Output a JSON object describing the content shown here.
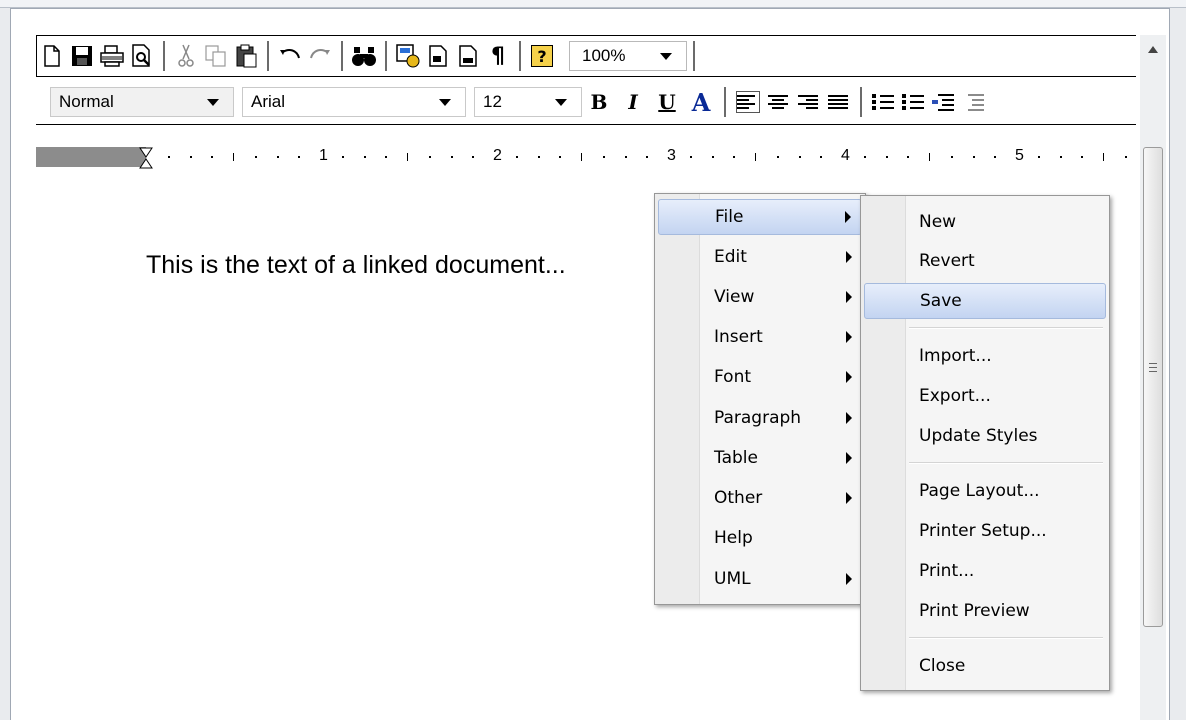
{
  "toolbar": {
    "zoom": "100%",
    "style_value": "Normal",
    "font_value": "Arial",
    "size_value": "12",
    "bold_label": "B",
    "italic_label": "I",
    "underline_label": "U",
    "font_color_label": "A",
    "paragraph_mark": "¶",
    "help_label": "?"
  },
  "ruler": {
    "numbers": [
      "1",
      "2",
      "3",
      "4",
      "5"
    ]
  },
  "document": {
    "text": "This is the text of a linked document..."
  },
  "context_menu": {
    "items": [
      {
        "label": "File",
        "has_submenu": true,
        "highlighted": true
      },
      {
        "label": "Edit",
        "has_submenu": true
      },
      {
        "label": "View",
        "has_submenu": true
      },
      {
        "label": "Insert",
        "has_submenu": true
      },
      {
        "label": "Font",
        "has_submenu": true
      },
      {
        "label": "Paragraph",
        "has_submenu": true
      },
      {
        "label": "Table",
        "has_submenu": true
      },
      {
        "label": "Other",
        "has_submenu": true
      },
      {
        "label": "Help",
        "has_submenu": false
      },
      {
        "label": "UML",
        "has_submenu": true
      }
    ]
  },
  "file_submenu": {
    "items": [
      {
        "label": "New"
      },
      {
        "label": "Revert"
      },
      {
        "label": "Save",
        "highlighted": true
      },
      {
        "label": "Import..."
      },
      {
        "label": "Export..."
      },
      {
        "label": "Update Styles"
      },
      {
        "label": "Page Layout..."
      },
      {
        "label": "Printer Setup..."
      },
      {
        "label": "Print..."
      },
      {
        "label": "Print Preview"
      },
      {
        "label": "Close"
      }
    ]
  },
  "colors": {
    "menu_highlight": "#c3d4f1",
    "ruler_margin": "#8c8c8c",
    "font_color_icon": "#0a2a96"
  }
}
